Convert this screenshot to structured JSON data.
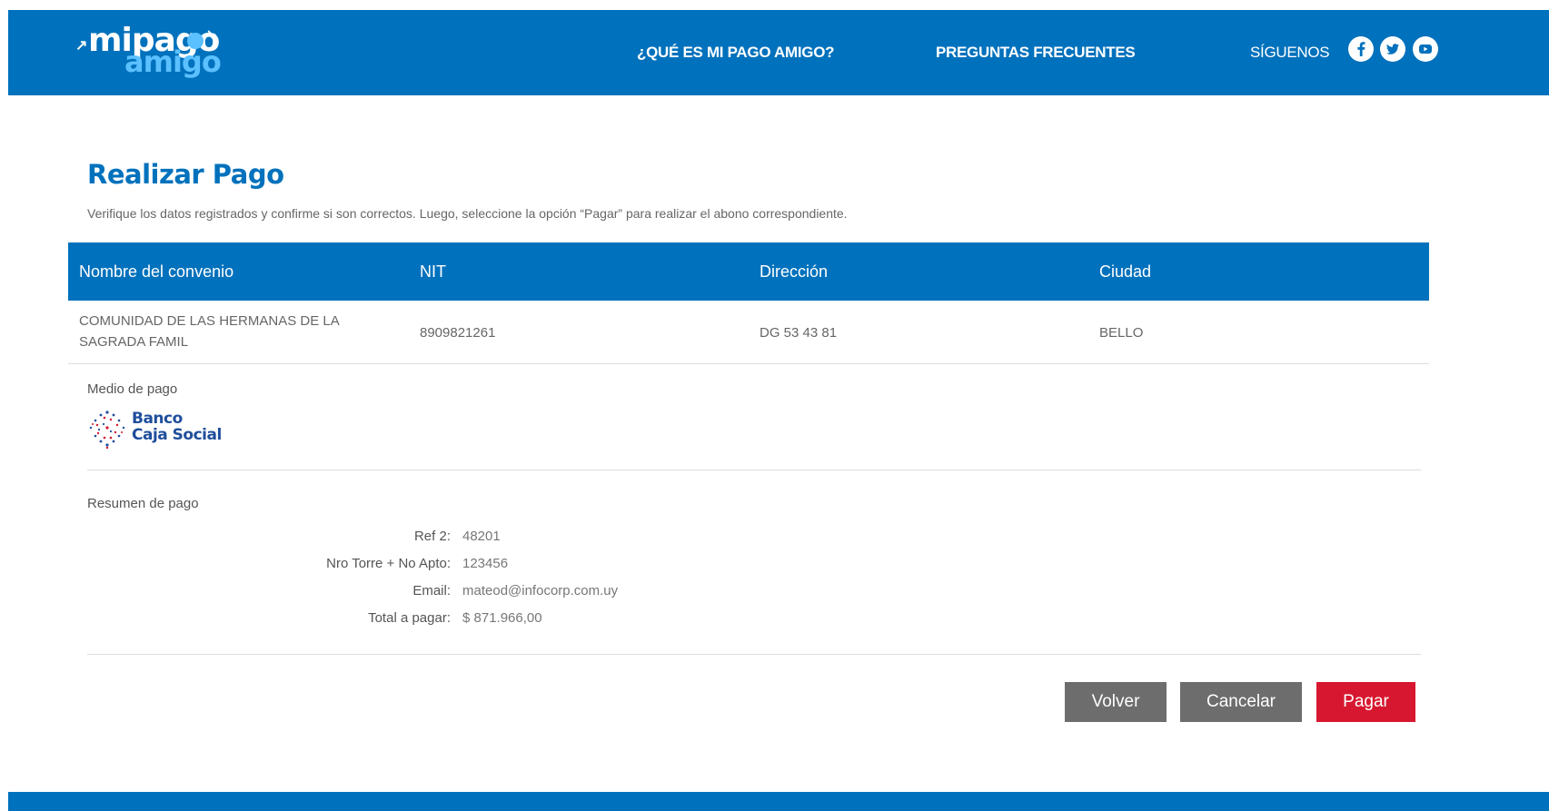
{
  "header": {
    "logo": {
      "word1": "mipago",
      "word2": "amigo"
    },
    "nav": [
      {
        "label": "¿QUÉ ES MI PAGO AMIGO?"
      },
      {
        "label": "PREGUNTAS FRECUENTES"
      }
    ],
    "follow_label": "SÍGUENOS",
    "social": [
      "facebook-icon",
      "twitter-icon",
      "youtube-icon"
    ]
  },
  "main": {
    "title": "Realizar Pago",
    "intro": "Verifique los datos registrados y confirme si son correctos. Luego, seleccione la opción “Pagar” para realizar el abono correspondiente.",
    "table": {
      "columns": [
        "Nombre del convenio",
        "NIT",
        "Dirección",
        "Ciudad"
      ],
      "rows": [
        [
          "COMUNIDAD DE LAS HERMANAS DE LA SAGRADA FAMIL",
          "8909821261",
          "DG 53 43 81",
          "BELLO"
        ]
      ]
    },
    "payment_method": {
      "label": "Medio de pago",
      "bank_line1": "Banco",
      "bank_line2": "Caja Social"
    },
    "summary": {
      "label": "Resumen de pago",
      "items": [
        {
          "key": "Ref 2:",
          "value": "48201"
        },
        {
          "key": "Nro Torre + No Apto:",
          "value": "123456"
        },
        {
          "key": "Email:",
          "value": "mateod@infocorp.com.uy"
        },
        {
          "key": "Total a pagar:",
          "value": "$ 871.966,00"
        }
      ]
    },
    "buttons": {
      "back": "Volver",
      "cancel": "Cancelar",
      "pay": "Pagar"
    }
  },
  "colors": {
    "brand_blue": "#0071bc",
    "logo_light_blue": "#5bc0ff",
    "button_gray": "#6d6d6d",
    "pay_red": "#d7172f",
    "bank_navy": "#1f4e9c"
  }
}
